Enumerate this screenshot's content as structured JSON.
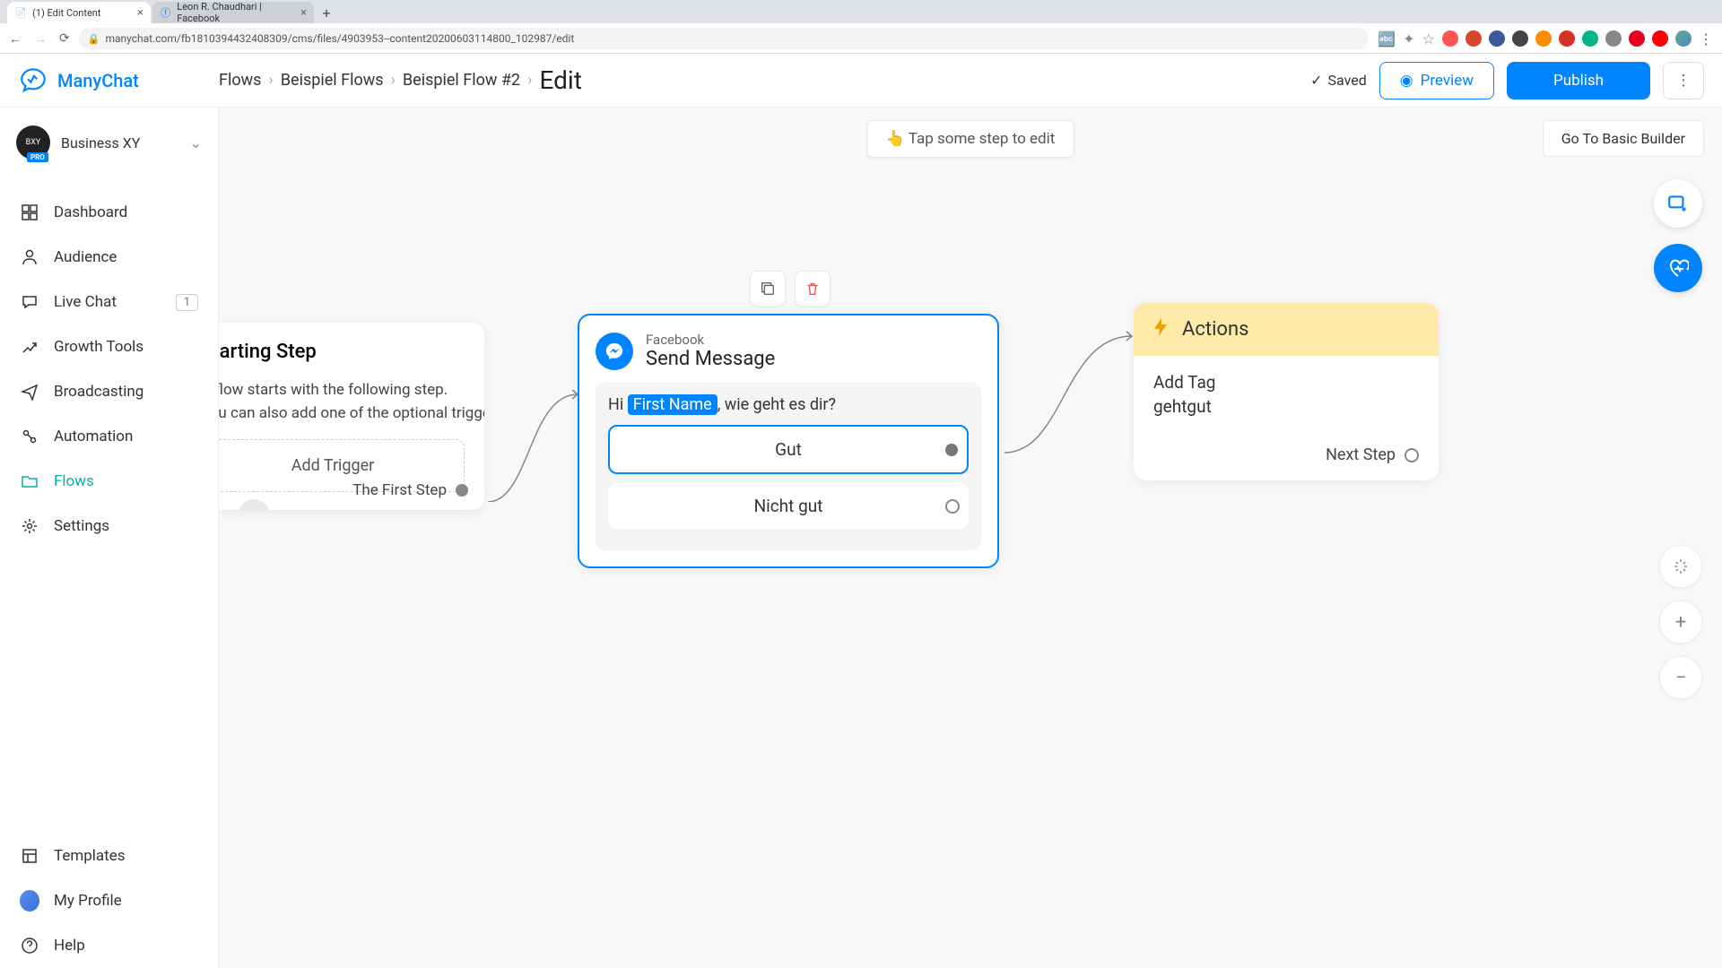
{
  "browser": {
    "tabs": [
      {
        "title": "(1) Edit Content",
        "active": true
      },
      {
        "title": "Leon R. Chaudhari | Facebook",
        "active": false
      }
    ],
    "url": "manychat.com/fb181039443240830​9/cms/files/4903953--content20200603114800_102987/edit"
  },
  "app": {
    "brand": "ManyChat",
    "workspace": "Business XY",
    "pro_label": "PRO"
  },
  "breadcrumbs": [
    "Flows",
    "Beispiel Flows",
    "Beispiel Flow #2"
  ],
  "current_page": "Edit",
  "header": {
    "saved": "Saved",
    "preview": "Preview",
    "publish": "Publish"
  },
  "sidebar": {
    "items": [
      {
        "label": "Dashboard"
      },
      {
        "label": "Audience"
      },
      {
        "label": "Live Chat",
        "badge": "1"
      },
      {
        "label": "Growth Tools"
      },
      {
        "label": "Broadcasting"
      },
      {
        "label": "Automation"
      },
      {
        "label": "Flows",
        "active": true
      },
      {
        "label": "Settings"
      }
    ],
    "bottom": [
      {
        "label": "Templates"
      },
      {
        "label": "My Profile"
      },
      {
        "label": "Help"
      }
    ]
  },
  "canvas": {
    "hint": "Tap some step to edit",
    "go_basic": "Go To Basic Builder"
  },
  "nodes": {
    "start": {
      "title": "Starting Step",
      "desc1": "A flow starts with the following step.",
      "desc2": "You can also add one of the optional triggers.",
      "add_trigger": "Add Trigger",
      "first_step": "The First Step"
    },
    "message": {
      "channel": "Facebook",
      "title": "Send Message",
      "text_prefix": "Hi ",
      "variable": "First Name",
      "text_suffix": ", wie geht es dir?",
      "buttons": [
        "Gut",
        "Nicht gut"
      ]
    },
    "actions": {
      "title": "Actions",
      "action_label": "Add Tag",
      "action_value": "gehtgut",
      "next_step": "Next Step"
    }
  }
}
